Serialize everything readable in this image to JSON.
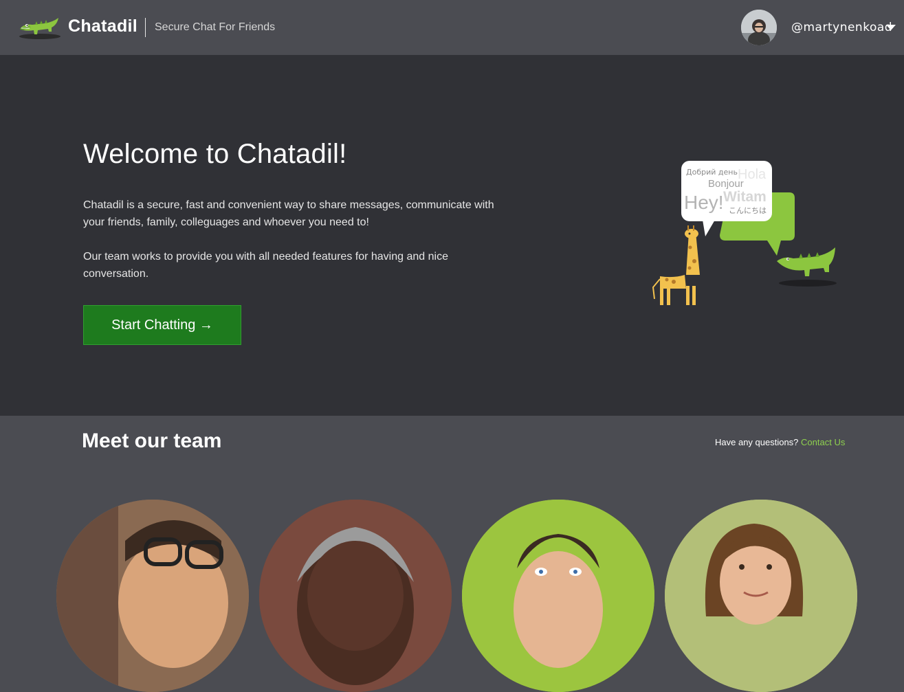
{
  "header": {
    "brand": "Chatadil",
    "tagline": "Secure Chat For Friends",
    "username": "@martynenkoad"
  },
  "hero": {
    "title": "Welcome to Chatadil!",
    "paragraph1": "Chatadil is a secure, fast and convenient way to share messages, communicate with your friends, family, colleguages and whoever you need to!",
    "paragraph2": "Our team works to provide you with all needed features for having and nice conversation.",
    "cta_label": "Start Chatting →",
    "bubble_words": [
      "Добрий день",
      "Hola",
      "Bonjour",
      "Hey!",
      "Witam",
      "こんにちは"
    ]
  },
  "team": {
    "title": "Meet our team",
    "questions_text": "Have any questions?",
    "contact_label": "Contact Us"
  },
  "colors": {
    "accent_green": "#8fd14f",
    "button_green": "#1e7b1e",
    "hero_bg": "#303136",
    "header_bg": "#4b4c52"
  },
  "icons": {
    "logo": "crocodile-logo-icon",
    "dropdown": "caret-down-icon"
  }
}
